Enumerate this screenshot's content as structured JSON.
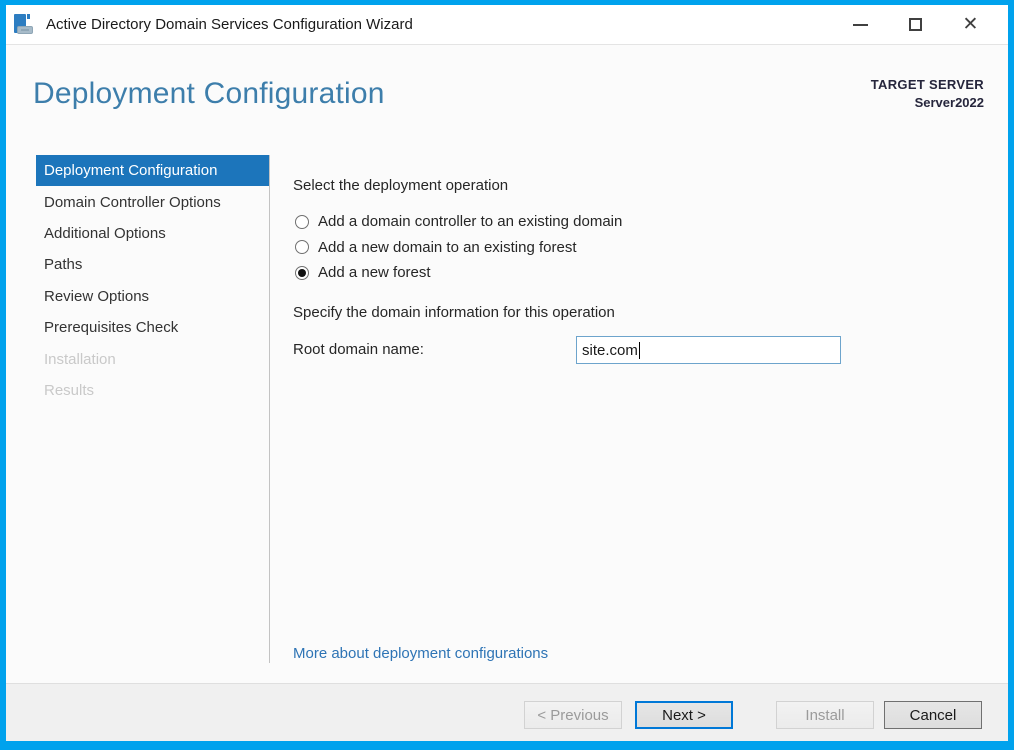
{
  "window": {
    "title": "Active Directory Domain Services Configuration Wizard",
    "controls": {
      "minimize": "minimize",
      "maximize": "maximize",
      "close": "✕"
    }
  },
  "header": {
    "title": "Deployment Configuration",
    "target_server_label": "TARGET SERVER",
    "target_server_value": "Server2022"
  },
  "sidebar": {
    "items": [
      {
        "label": "Deployment Configuration",
        "state": "selected"
      },
      {
        "label": "Domain Controller Options",
        "state": "enabled"
      },
      {
        "label": "Additional Options",
        "state": "enabled"
      },
      {
        "label": "Paths",
        "state": "enabled"
      },
      {
        "label": "Review Options",
        "state": "enabled"
      },
      {
        "label": "Prerequisites Check",
        "state": "enabled"
      },
      {
        "label": "Installation",
        "state": "disabled"
      },
      {
        "label": "Results",
        "state": "disabled"
      }
    ]
  },
  "main": {
    "operation_section_label": "Select the deployment operation",
    "radio_options": [
      {
        "label": "Add a domain controller to an existing domain",
        "selected": false
      },
      {
        "label": "Add a new domain to an existing forest",
        "selected": false
      },
      {
        "label": "Add a new forest",
        "selected": true
      }
    ],
    "domain_section_label": "Specify the domain information for this operation",
    "root_domain_label": "Root domain name:",
    "root_domain_value": "site.com",
    "more_link": "More about deployment configurations"
  },
  "footer": {
    "buttons": [
      {
        "label": "< Previous",
        "state": "disabled"
      },
      {
        "label": "Next >",
        "state": "default"
      },
      {
        "label": "Install",
        "state": "disabled"
      },
      {
        "label": "Cancel",
        "state": "enabled"
      }
    ]
  },
  "colors": {
    "accent_border": "#00A2ED",
    "selected_nav": "#1C75BB",
    "header_title": "#3D7EAB",
    "link": "#2E74B5",
    "default_button_border": "#0078D7",
    "input_border": "#6DA4CC"
  }
}
